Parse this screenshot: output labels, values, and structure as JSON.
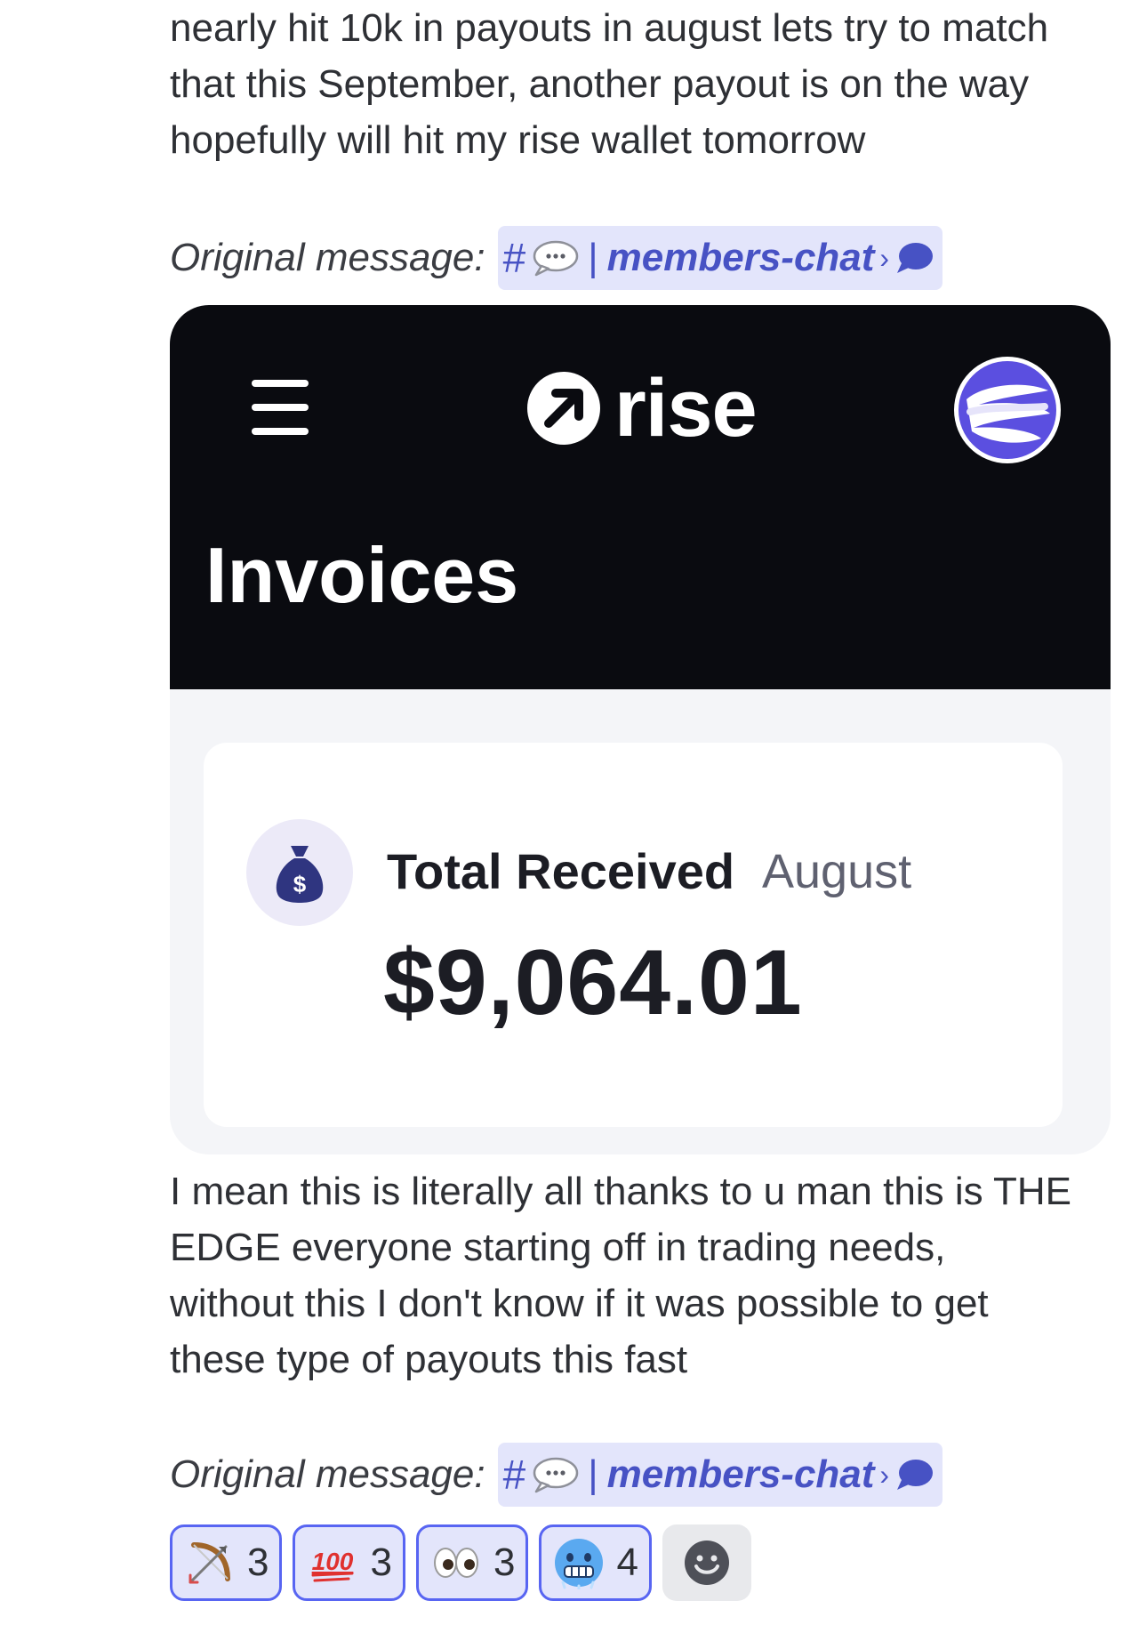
{
  "messages": [
    {
      "text": "nearly hit 10k in payouts in august lets try to match\nthat this September, another payout is on the way\nhopefully will hit my rise wallet tomorrow"
    },
    {
      "text": "I mean this is literally all thanks to u man this is THE\nEDGE everyone starting off in trading needs,\nwithout this I don't know if it was possible to get\nthese type of payouts this fast"
    }
  ],
  "original_message": {
    "label": "Original message:",
    "channel_hash": "#",
    "channel_separator": "|",
    "channel_name": "members-chat",
    "arrow": "›",
    "bubble_icon": "speech-bubble-icon",
    "thread_icon": "thread-bubble-icon"
  },
  "embed": {
    "app_name": "rise",
    "page_title": "Invoices",
    "card": {
      "label": "Total Received",
      "month": "August",
      "amount": "$9,064.01",
      "icon": "money-bag-icon"
    },
    "colors": {
      "header_bg": "#0a0b10",
      "body_bg": "#f4f5f8",
      "accent_avatar": "#5b4fe0"
    }
  },
  "reactions": [
    {
      "emoji": "bow-and-arrow",
      "count": "3"
    },
    {
      "emoji": "hundred-points",
      "count": "3"
    },
    {
      "emoji": "eyes",
      "count": "3"
    },
    {
      "emoji": "cold-face",
      "count": "4"
    }
  ],
  "add_reaction_icon": "add-reaction-smiley-icon",
  "colors": {
    "channel_pill_bg": "#e3e5fb",
    "channel_text": "#4752c4",
    "reaction_border": "#5865f2"
  }
}
